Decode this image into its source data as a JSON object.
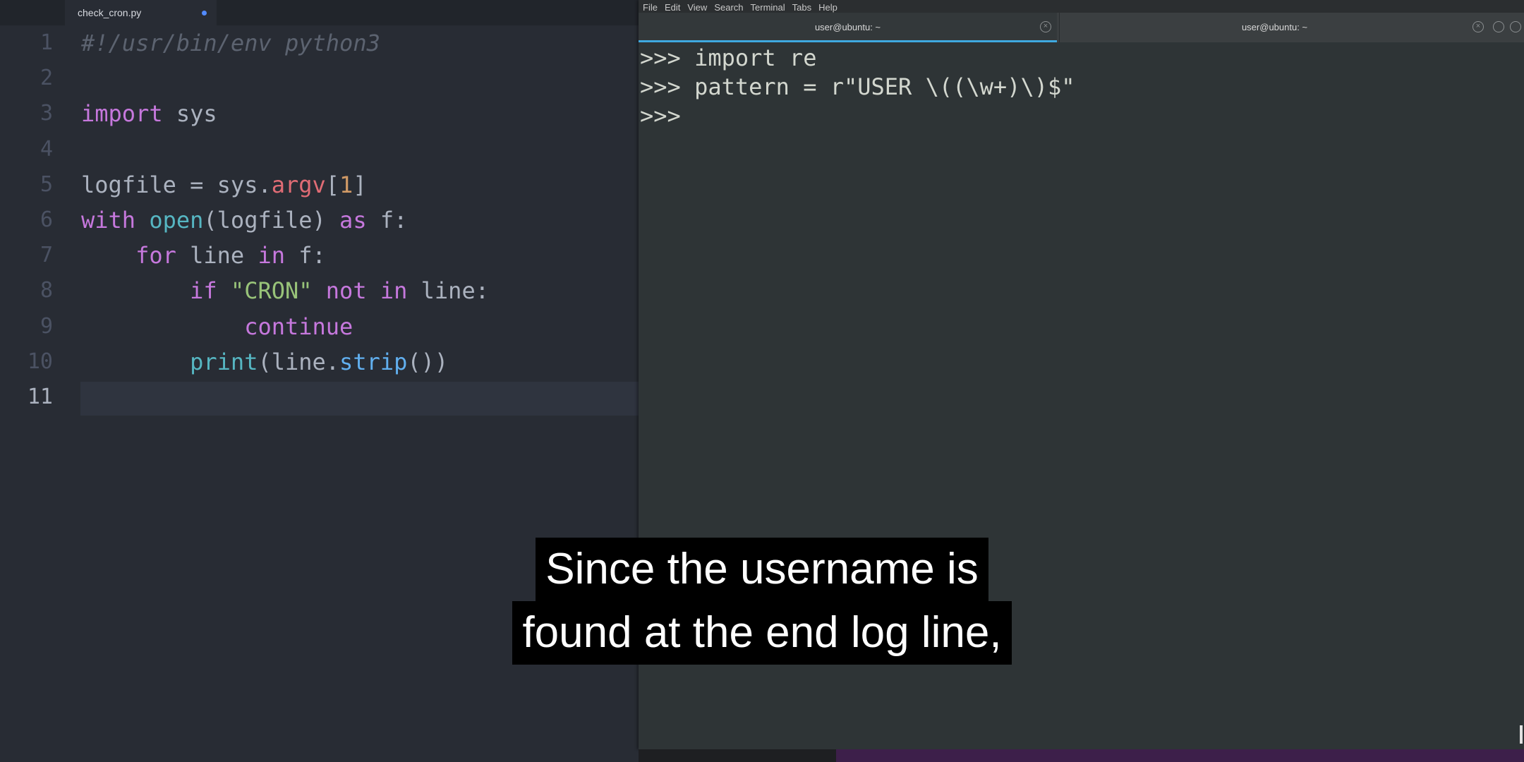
{
  "editor": {
    "tab": {
      "filename": "check_cron.py",
      "modified": true
    },
    "line_numbers": [
      "1",
      "2",
      "3",
      "4",
      "5",
      "6",
      "7",
      "8",
      "9",
      "10",
      "11"
    ],
    "current_line": "11",
    "lines": [
      [
        {
          "t": "#!/usr/bin/env python3",
          "c": "comment"
        }
      ],
      [],
      [
        {
          "t": "import",
          "c": "kw"
        },
        {
          "t": " sys",
          "c": "var"
        }
      ],
      [],
      [
        {
          "t": "logfile = sys.",
          "c": "var"
        },
        {
          "t": "argv",
          "c": "attr"
        },
        {
          "t": "[",
          "c": "punc"
        },
        {
          "t": "1",
          "c": "num"
        },
        {
          "t": "]",
          "c": "punc"
        }
      ],
      [
        {
          "t": "with",
          "c": "kw"
        },
        {
          "t": " ",
          "c": "var"
        },
        {
          "t": "open",
          "c": "builtin"
        },
        {
          "t": "(logfile) ",
          "c": "var"
        },
        {
          "t": "as",
          "c": "kw"
        },
        {
          "t": " f:",
          "c": "var"
        }
      ],
      [
        {
          "t": "    ",
          "c": "var"
        },
        {
          "t": "for",
          "c": "kw"
        },
        {
          "t": " line ",
          "c": "var"
        },
        {
          "t": "in",
          "c": "kw"
        },
        {
          "t": " f:",
          "c": "var"
        }
      ],
      [
        {
          "t": "        ",
          "c": "var"
        },
        {
          "t": "if",
          "c": "kw"
        },
        {
          "t": " ",
          "c": "var"
        },
        {
          "t": "\"CRON\"",
          "c": "str"
        },
        {
          "t": " ",
          "c": "var"
        },
        {
          "t": "not in",
          "c": "kw"
        },
        {
          "t": " line:",
          "c": "var"
        }
      ],
      [
        {
          "t": "            ",
          "c": "var"
        },
        {
          "t": "continue",
          "c": "kw"
        }
      ],
      [
        {
          "t": "        ",
          "c": "var"
        },
        {
          "t": "print",
          "c": "builtin"
        },
        {
          "t": "(line.",
          "c": "var"
        },
        {
          "t": "strip",
          "c": "fn"
        },
        {
          "t": "())",
          "c": "var"
        }
      ],
      []
    ]
  },
  "terminal": {
    "menu": [
      "File",
      "Edit",
      "View",
      "Search",
      "Terminal",
      "Tabs",
      "Help"
    ],
    "tabs": [
      {
        "label": "user@ubuntu: ~",
        "active": true
      },
      {
        "label": "user@ubuntu: ~",
        "active": false
      }
    ],
    "lines": [
      ">>> import re",
      ">>> pattern = r\"USER \\((\\w+)\\)$\"",
      ">>> "
    ]
  },
  "caption": {
    "line1": "Since the username is",
    "line2": "found at the end log line,"
  },
  "colors": {
    "editor_bg": "#282c34",
    "terminal_bg": "#2e3436",
    "tab_accent": "#3fa9e0",
    "keyword": "#c678dd",
    "string": "#98c379",
    "number": "#d19a66"
  }
}
